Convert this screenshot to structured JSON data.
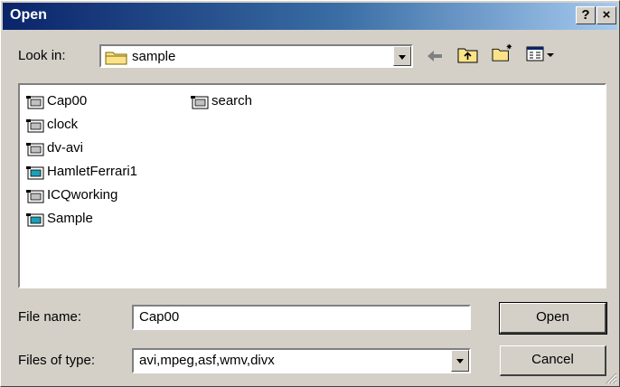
{
  "window": {
    "title": "Open",
    "help_button": "?",
    "close_button": "×"
  },
  "look_in": {
    "label": "Look in:",
    "value": "sample"
  },
  "toolbar": {
    "back_icon": "back-arrow-icon",
    "up_icon": "up-folder-icon",
    "new_folder_icon": "new-folder-icon",
    "view_menu_icon": "view-menu-icon"
  },
  "files": [
    {
      "name": "Cap00",
      "type": "video"
    },
    {
      "name": "clock",
      "type": "video"
    },
    {
      "name": "dv-avi",
      "type": "video"
    },
    {
      "name": "HamletFerrari1",
      "type": "video-alt"
    },
    {
      "name": "ICQworking",
      "type": "video"
    },
    {
      "name": "Sample",
      "type": "video-alt"
    },
    {
      "name": "search",
      "type": "video"
    }
  ],
  "file_name": {
    "label": "File name:",
    "value": "Cap00"
  },
  "file_type": {
    "label": "Files of type:",
    "value": "avi,mpeg,asf,wmv,divx"
  },
  "buttons": {
    "open": "Open",
    "cancel": "Cancel"
  },
  "colors": {
    "titlebar_start": "#0a246a",
    "titlebar_end": "#a6caf0",
    "face": "#d4d0c8"
  }
}
